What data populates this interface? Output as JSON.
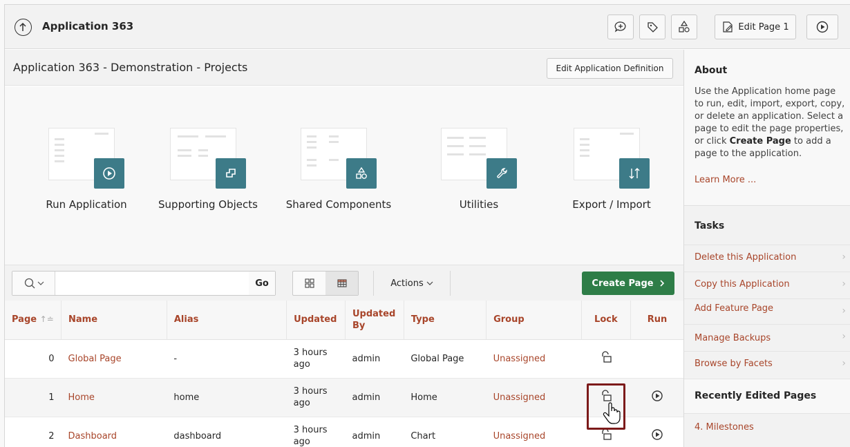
{
  "app": {
    "title": "Application 363"
  },
  "toolbar_top": {
    "edit_page_label": "Edit Page 1"
  },
  "region": {
    "title": "Application 363 - Demonstration - Projects",
    "edit_def_label": "Edit Application Definition"
  },
  "tiles": [
    {
      "label": "Run Application",
      "icon": "play-icon"
    },
    {
      "label": "Supporting Objects",
      "icon": "supporting-objects-icon"
    },
    {
      "label": "Shared Components",
      "icon": "shapes-icon"
    },
    {
      "label": "Utilities",
      "icon": "wrench-icon"
    },
    {
      "label": "Export / Import",
      "icon": "arrows-updown-icon"
    }
  ],
  "report_toolbar": {
    "search_value": "",
    "go_label": "Go",
    "actions_label": "Actions",
    "create_label": "Create Page"
  },
  "table": {
    "headers": [
      "Page",
      "Name",
      "Alias",
      "Updated",
      "Updated By",
      "Type",
      "Group",
      "Lock",
      "Run"
    ],
    "rows": [
      {
        "page": "0",
        "name": "Global Page",
        "alias": "-",
        "updated": "3 hours ago",
        "by": "admin",
        "type": "Global Page",
        "group": "Unassigned",
        "run": false
      },
      {
        "page": "1",
        "name": "Home",
        "alias": "home",
        "updated": "3 hours ago",
        "by": "admin",
        "type": "Home",
        "group": "Unassigned",
        "run": true
      },
      {
        "page": "2",
        "name": "Dashboard",
        "alias": "dashboard",
        "updated": "3 hours ago",
        "by": "admin",
        "type": "Chart",
        "group": "Unassigned",
        "run": true
      }
    ]
  },
  "side": {
    "about_title": "About",
    "about_text_1": "Use the Application home page to run, edit, import, export, copy, or delete an application. Select a page to edit the page properties, or click ",
    "about_bold": "Create Page",
    "about_text_2": " to add a page to the application.",
    "learn_more": "Learn More ...",
    "tasks_title": "Tasks",
    "tasks": [
      "Delete this Application",
      "Copy this Application",
      "Add Feature Page",
      "Manage Backups",
      "Browse by Facets"
    ],
    "recent_title": "Recently Edited Pages",
    "recent": [
      "4. Milestones"
    ]
  },
  "colors": {
    "accent_link": "#a8452a",
    "tile_badge": "#3d7b88",
    "create_button": "#2e7d47",
    "highlight": "#7c1a1a"
  }
}
